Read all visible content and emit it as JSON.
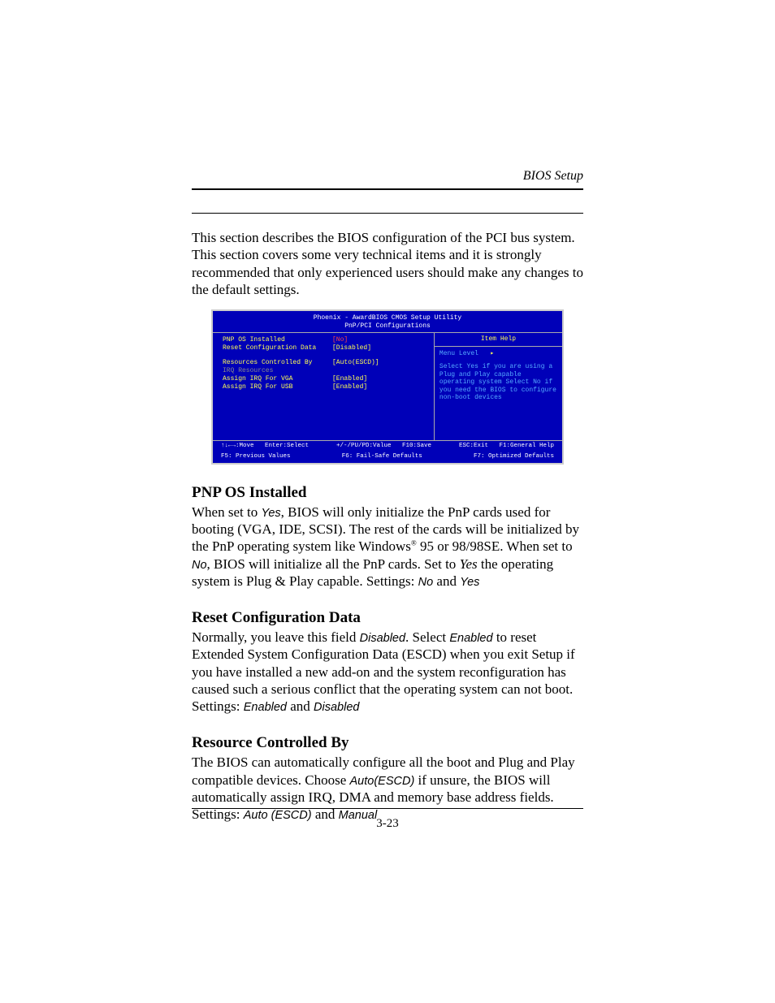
{
  "header": {
    "label": "BIOS Setup"
  },
  "intro": "This section describes the BIOS configuration of the PCI bus system. This section covers some very technical items and it is strongly recommended that only experienced users should make any changes to the default settings.",
  "bios": {
    "title_line1": "Phoenix - AwardBIOS CMOS Setup Utility",
    "title_line2": "PnP/PCI Configurations",
    "settings": [
      {
        "label": "PNP OS Installed",
        "value": "[No]",
        "selected": true
      },
      {
        "label": "Reset Configuration Data",
        "value": "[Disabled]"
      },
      {
        "label": "__spacer__"
      },
      {
        "label": "Resources Controlled By",
        "value": "[Auto(ESCD)]"
      },
      {
        "label": "IRQ Resources",
        "value": "",
        "dim": true
      },
      {
        "label": "Assign IRQ For VGA",
        "value": "[Enabled]"
      },
      {
        "label": "Assign IRQ For USB",
        "value": "[Enabled]"
      }
    ],
    "itemhelp_header": "Item Help",
    "menulevel_label": "Menu Level",
    "menulevel_arrow": "▸",
    "help_text": "Select Yes if you are using a Plug and Play capable operating system Select No if you need the BIOS to configure non-boot devices",
    "footer": {
      "l1c1": "↑↓←→:Move   Enter:Select",
      "l1c2": "+/-/PU/PD:Value   F10:Save",
      "l1c3": "ESC:Exit   F1:General Help",
      "l2c1": "F5: Previous Values",
      "l2c2": "F6: Fail-Safe Defaults",
      "l2c3": "F7: Optimized Defaults"
    }
  },
  "sections": {
    "pnp": {
      "heading": "PNP OS Installed",
      "p1a": "When set to ",
      "yes": "Yes",
      "p1b": ", BIOS will only initialize the PnP cards used for booting (VGA, IDE, SCSI). The rest of the cards will be initialized by the PnP operating system like Windows",
      "sup": "®",
      "p1c": " 95 or 98/98SE. When set to ",
      "no": "No",
      "p1d": ", BIOS will initialize all the PnP cards. Set to ",
      "yes2": "Yes",
      "p1e": " the operating system is Plug & Play capable. Settings: ",
      "no2": "No",
      "and": " and ",
      "yes3": "Yes"
    },
    "reset": {
      "heading": "Reset Configuration Data",
      "p1a": "Normally, you leave this field ",
      "disabled": "Disabled",
      "p1b": ". Select ",
      "enabled": "Enabled",
      "p1c": " to reset Extended System Configuration Data (ESCD) when you exit Setup if you have installed a new add-on and the system reconfiguration has caused such a serious conflict that the operating system can not boot. Settings: ",
      "enabled2": "Enabled",
      "and": " and ",
      "disabled2": "Disabled"
    },
    "resource": {
      "heading": "Resource Controlled By",
      "p1a": "The BIOS can automatically configure all the boot and Plug and Play compatible devices. Choose ",
      "auto": "Auto(ESCD)",
      "p1b": " if unsure, the BIOS will automatically assign IRQ, DMA and memory base address fields. Settings: ",
      "auto2": "Auto (ESCD)",
      "and": " and ",
      "manual": "Manual"
    }
  },
  "pagenum": "3-23"
}
